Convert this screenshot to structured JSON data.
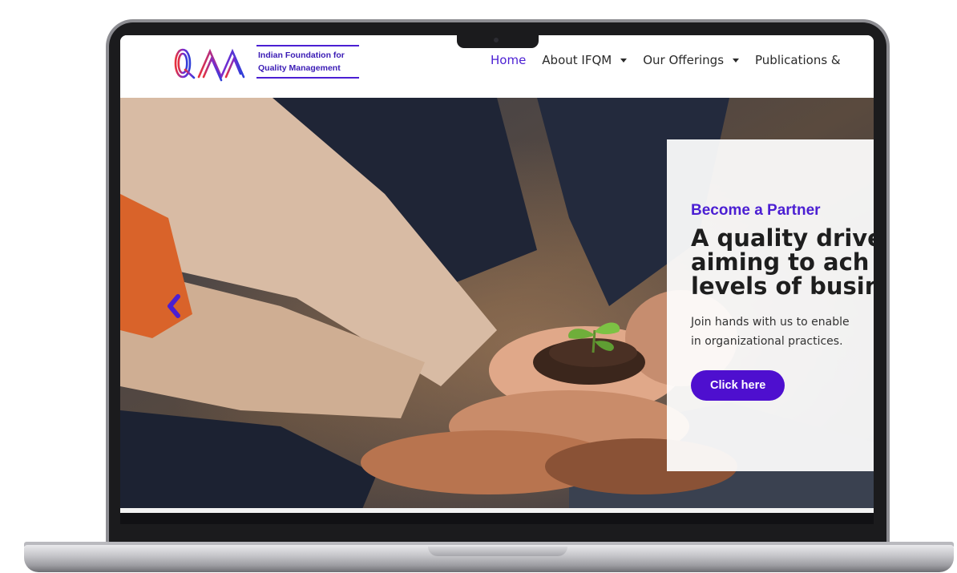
{
  "brand": {
    "logo_letters": "IFQM",
    "tagline_line1": "Indian Foundation for",
    "tagline_line2": "Quality Management",
    "colors": {
      "primary": "#4b1fd3",
      "logo_red": "#e8323c",
      "logo_blue": "#2f3fd8"
    }
  },
  "nav": {
    "items": [
      {
        "label": "Home",
        "active": true,
        "has_dropdown": false
      },
      {
        "label": "About IFQM",
        "active": false,
        "has_dropdown": true
      },
      {
        "label": "Our Offerings",
        "active": false,
        "has_dropdown": true
      },
      {
        "label": "Publications &",
        "active": false,
        "has_dropdown": false
      }
    ]
  },
  "hero": {
    "eyebrow": "Become a Partner",
    "headline_line1": "A quality drive",
    "headline_line2": "aiming to ach",
    "headline_line3": "levels of busin",
    "body_line1": "Join hands with us to enable",
    "body_line2": "in organizational practices.",
    "cta_label": "Click here",
    "prev_icon": "chevron-left-icon",
    "image_subject": "hands-holding-seedling-photo"
  }
}
